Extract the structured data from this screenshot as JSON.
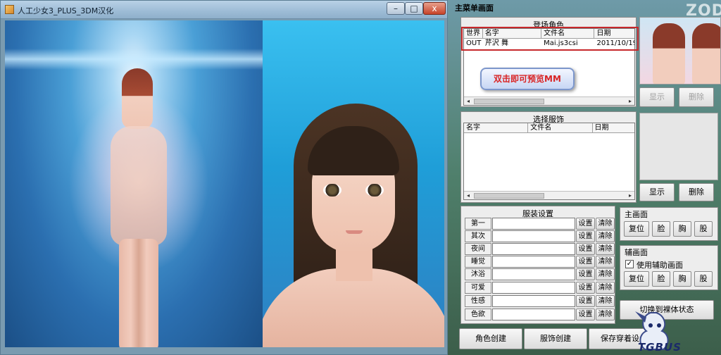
{
  "game_window": {
    "title": "人工少女3_PLUS_3DM汉化",
    "min_label": "–",
    "max_label": "□",
    "close_label": "x"
  },
  "panel": {
    "title": "主菜单画面",
    "watermark": "ZOD",
    "characters": {
      "label": "登场角色",
      "columns": [
        "世界",
        "名字",
        "文件名",
        "日期"
      ],
      "rows": [
        {
          "world": "OUT",
          "name": "芹沢 舞",
          "file": "Mai.js3csi",
          "date": "2011/10/19"
        }
      ],
      "show_button": "显示",
      "delete_button": "删除"
    },
    "callout": "双击即可预览MM",
    "costumes": {
      "label": "选择服饰",
      "columns": [
        "名字",
        "文件名",
        "日期"
      ],
      "show_button": "显示",
      "delete_button": "删除"
    },
    "outfit": {
      "label": "服装设置",
      "set_label": "设置",
      "clear_label": "清除",
      "slots": [
        "第一",
        "其次",
        "夜间",
        "睡觉",
        "沐浴",
        "可爱",
        "性感",
        "色欲"
      ]
    },
    "main_screen": {
      "label": "主画面",
      "buttons": [
        "复位",
        "脸",
        "胸",
        "股"
      ]
    },
    "sub_screen": {
      "label": "辅画面",
      "checkbox_label": "使用辅助画面",
      "checkbox_checked": true,
      "buttons": [
        "复位",
        "脸",
        "胸",
        "股"
      ]
    },
    "nude_button": "切换到裸体状态",
    "bottom_buttons": {
      "create_character": "角色创建",
      "create_costume": "服饰创建",
      "save_outfit": "保存穿着设"
    },
    "logo_text": "TGBUS"
  },
  "colors": {
    "highlight": "#c7282b",
    "callout_text": "#d92424"
  }
}
